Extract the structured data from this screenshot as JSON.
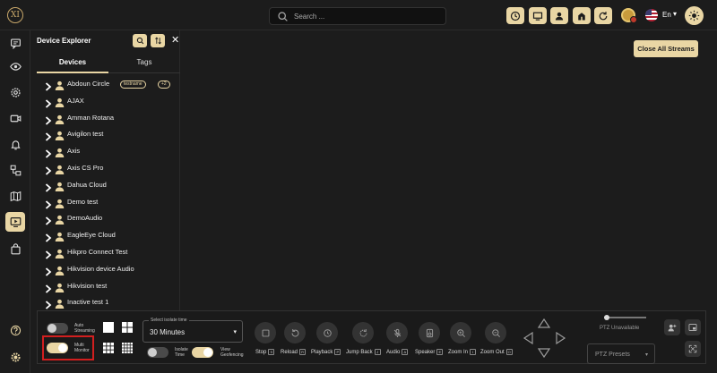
{
  "topbar": {
    "logo_text": "XI",
    "search_placeholder": "Search ...",
    "language": "En"
  },
  "rail": {
    "icons": [
      "chat-icon",
      "eye-icon",
      "settings-icon",
      "camera-icon",
      "bell-icon",
      "devices-icon",
      "map-icon",
      "play-screen-icon",
      "bag-icon"
    ],
    "active": "play-screen-icon",
    "bottom_icons": [
      "help-icon",
      "gear-icon"
    ]
  },
  "explorer": {
    "title": "Device Explorer",
    "tabs": [
      "Devices",
      "Tags"
    ],
    "active_tab": "Devices",
    "devices": [
      {
        "name": "Abdoun Circle",
        "tag": "testname",
        "extra": "+2"
      },
      {
        "name": "AJAX"
      },
      {
        "name": "Amman Rotana"
      },
      {
        "name": "Avigilon test"
      },
      {
        "name": "Axis"
      },
      {
        "name": "Axis CS Pro"
      },
      {
        "name": "Dahua Cloud"
      },
      {
        "name": "Demo test"
      },
      {
        "name": "DemoAudio"
      },
      {
        "name": "EagleEye Cloud"
      },
      {
        "name": "Hikpro Connect Test"
      },
      {
        "name": "Hikvision device Audio"
      },
      {
        "name": "Hikvision test"
      },
      {
        "name": "Inactive test 1"
      }
    ]
  },
  "main": {
    "close_all_label": "Close All Streams"
  },
  "toolbar": {
    "auto_streaming_label_1": "Auto",
    "auto_streaming_label_2": "Streaming",
    "auto_streaming_on": false,
    "multi_monitor_label_1": "Multi",
    "multi_monitor_label_2": "Monitor",
    "multi_monitor_on": true,
    "isolate_legend": "Select isolate time",
    "isolate_value": "30 Minutes",
    "isolate_time_label_1": "Isolate",
    "isolate_time_label_2": "Time",
    "isolate_time_on": false,
    "view_geofencing_label_1": "View",
    "view_geofencing_label_2": "Geofencing",
    "view_geofencing_on": true,
    "controls": [
      {
        "label": "Stop",
        "key": "S"
      },
      {
        "label": "Reload",
        "key": "R"
      },
      {
        "label": "Playback",
        "key": "P"
      },
      {
        "label": "Jump Back",
        "key": "J"
      },
      {
        "label": "Audio",
        "key": "A"
      },
      {
        "label": "Speaker",
        "key": "E"
      },
      {
        "label": "Zoom In",
        "key": "I"
      },
      {
        "label": "Zoom Out",
        "key": "O"
      }
    ],
    "ptz_status": "PTZ Unavailable",
    "ptz_presets_placeholder": "PTZ Presets"
  },
  "colors": {
    "accent": "#e9d6a4",
    "background": "#1c1c1c",
    "highlight": "#d21f1f"
  }
}
